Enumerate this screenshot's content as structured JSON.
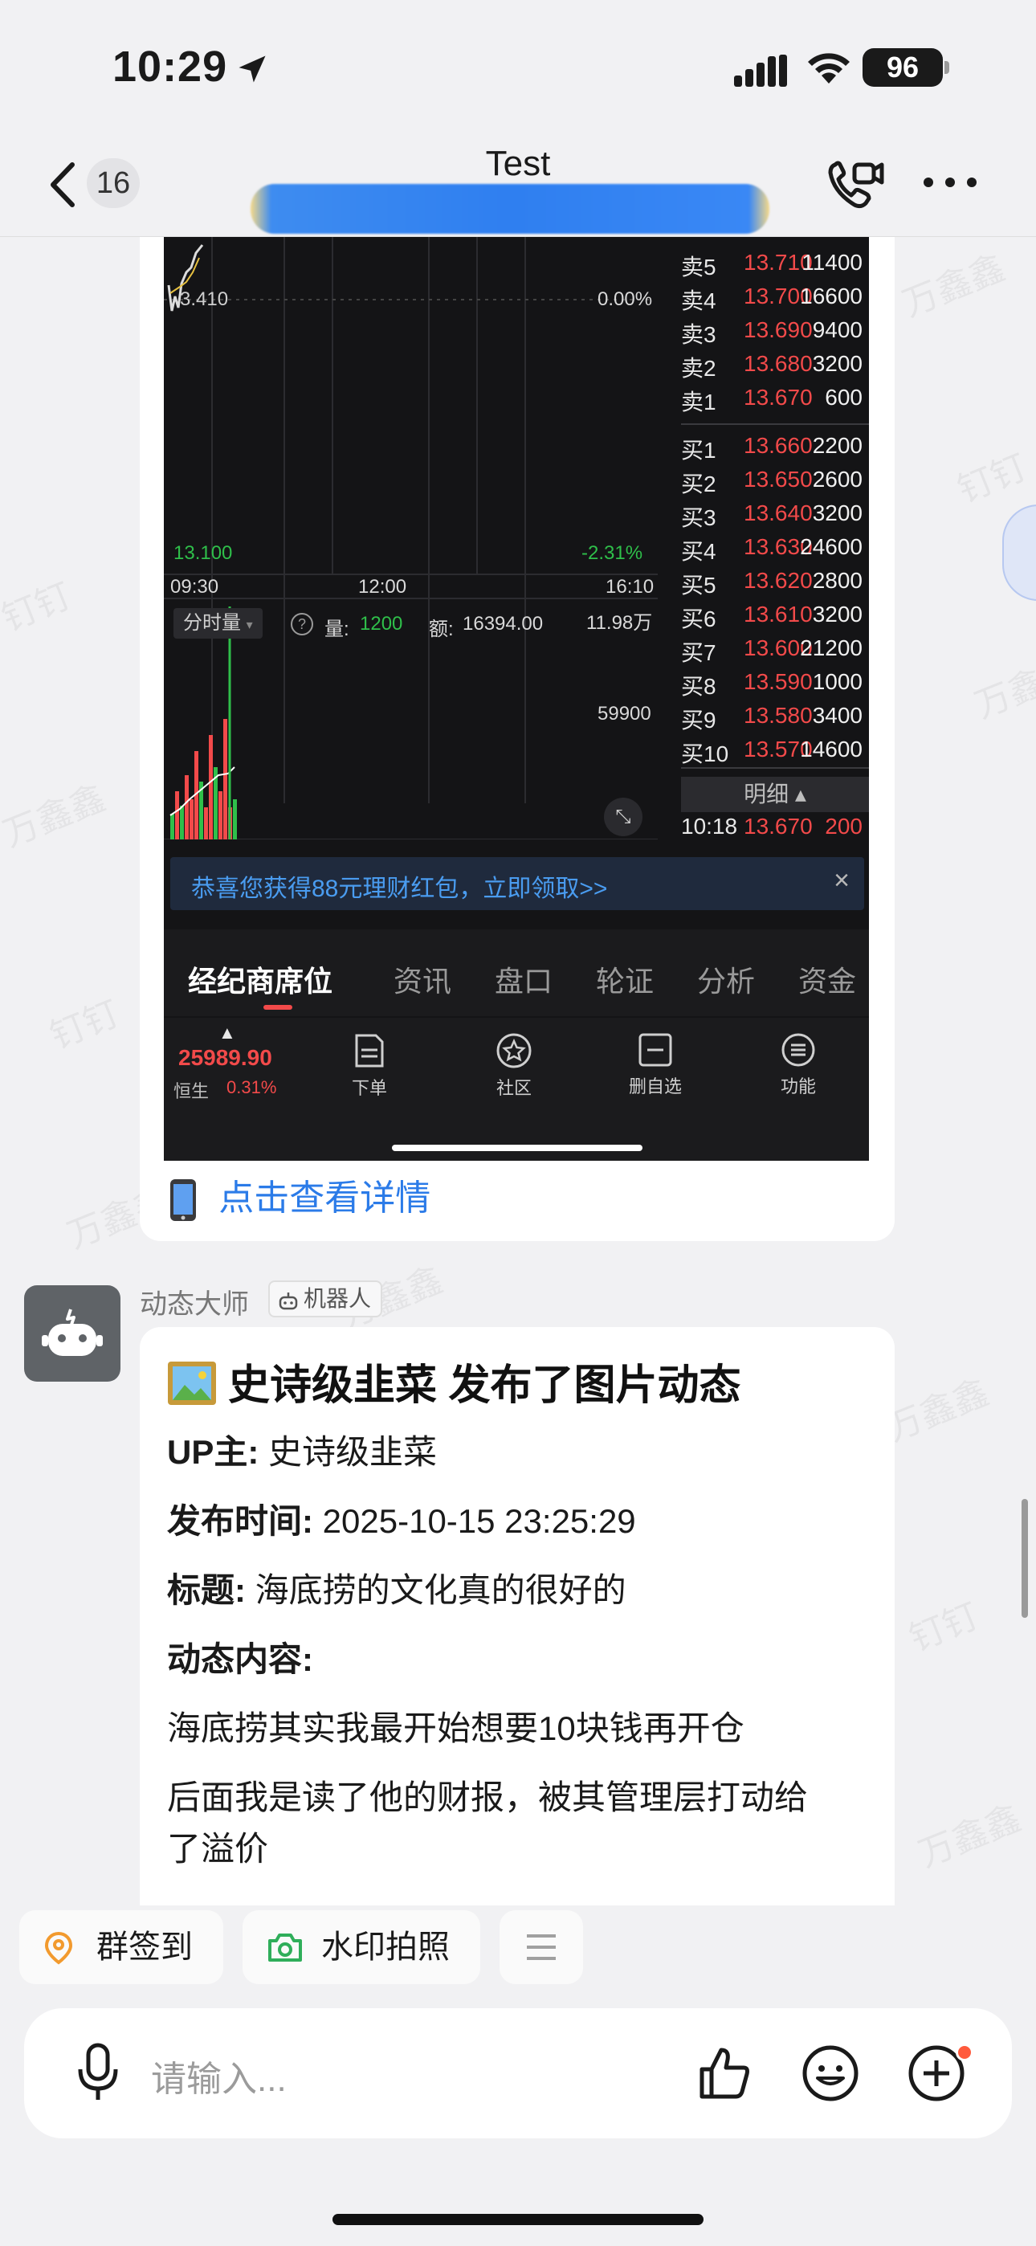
{
  "status_bar": {
    "time": "10:29",
    "battery": "96"
  },
  "nav": {
    "unread_count": "16",
    "title": "Test"
  },
  "watermark": "万鑫鑫",
  "watermark_alt": "钉钉",
  "stock": {
    "chart_labels": {
      "price_top": "3.410",
      "pct_top": "0.00%",
      "price_low": "13.100",
      "pct_low": "-2.31%",
      "t_open": "09:30",
      "t_mid": "12:00",
      "t_close": "16:10",
      "vol_mode": "分时量",
      "vol_label": "量:",
      "vol_value": "1200",
      "amt_label": "额:",
      "amt_value": "16394.00",
      "vol_axis_top": "11.98万",
      "vol_axis_mid": "59900"
    },
    "order_book": {
      "sell": [
        {
          "label": "卖5",
          "price": "13.710",
          "vol": "11400"
        },
        {
          "label": "卖4",
          "price": "13.700",
          "vol": "16600"
        },
        {
          "label": "卖3",
          "price": "13.690",
          "vol": "9400"
        },
        {
          "label": "卖2",
          "price": "13.680",
          "vol": "3200"
        },
        {
          "label": "卖1",
          "price": "13.670",
          "vol": "600"
        }
      ],
      "buy": [
        {
          "label": "买1",
          "price": "13.660",
          "vol": "2200"
        },
        {
          "label": "买2",
          "price": "13.650",
          "vol": "2600"
        },
        {
          "label": "买3",
          "price": "13.640",
          "vol": "3200"
        },
        {
          "label": "买4",
          "price": "13.630",
          "vol": "24600"
        },
        {
          "label": "买5",
          "price": "13.620",
          "vol": "2800"
        },
        {
          "label": "买6",
          "price": "13.610",
          "vol": "3200"
        },
        {
          "label": "买7",
          "price": "13.600",
          "vol": "21200"
        },
        {
          "label": "买8",
          "price": "13.590",
          "vol": "1000"
        },
        {
          "label": "买9",
          "price": "13.580",
          "vol": "3400"
        },
        {
          "label": "买10",
          "price": "13.570",
          "vol": "14600"
        }
      ],
      "detail_label": "明细 ▴",
      "last_trade": {
        "time": "10:18",
        "price": "13.670",
        "vol": "200"
      }
    },
    "banner": "恭喜您获得88元理财红包，立即领取>>",
    "tabs": [
      "经纪商席位",
      "资讯",
      "盘口",
      "轮证",
      "分析",
      "资金"
    ],
    "index": {
      "value": "25989.90",
      "name": "恒生",
      "pct": "0.31%"
    },
    "bottom_items": [
      "下单",
      "社区",
      "删自选",
      "功能"
    ]
  },
  "detail_link": "点击查看详情",
  "robot_message": {
    "sender": "动态大师",
    "tag": "机器人",
    "title": "史诗级韭菜 发布了图片动态",
    "up_label": "UP主:",
    "up_value": "史诗级韭菜",
    "time_label": "发布时间:",
    "time_value": "2025-10-15 23:25:29",
    "title_label": "标题:",
    "title_value": "海底捞的文化真的很好的",
    "content_label": "动态内容:",
    "content_line1": "海底捞其实我最开始想要10块钱再开仓",
    "content_line2a": "后面我是读了他的财报，被其管理层打动给",
    "content_line2b": "了溢价"
  },
  "quick_actions": [
    "群签到",
    "水印拍照"
  ],
  "input": {
    "placeholder": "请输入..."
  }
}
